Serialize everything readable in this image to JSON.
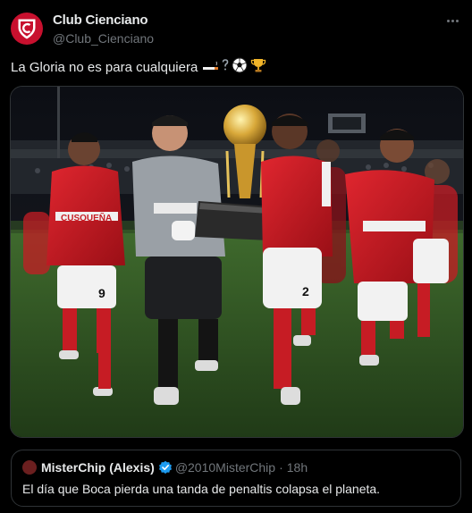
{
  "post": {
    "author": {
      "display_name": "Club Cienciano",
      "handle": "@Club_Cienciano",
      "avatar_icon": "club-cienciano-crest-icon"
    },
    "text": "La Gloria no es para cualquiera",
    "emojis": [
      "cigarette-emoji",
      "question-mark-emoji",
      "soccer-ball-emoji",
      "trophy-emoji"
    ],
    "media": {
      "description_icon": "team-celebration-photo",
      "jersey_sponsor": "CUSQUEÑA",
      "jersey_numbers": [
        "9",
        "2"
      ]
    },
    "quoted": {
      "display_name": "MisterChip (Alexis)",
      "handle": "@2010MisterChip",
      "separator": "·",
      "time": "18h",
      "text": "El día que Boca pierda una tanda de penaltis colapsa el planeta.",
      "verified_icon": "verified-badge-icon"
    }
  },
  "colors": {
    "background": "#000000",
    "text_primary": "#e7e9ea",
    "text_secondary": "#71767b",
    "border": "#2f3336",
    "verified": "#1d9bf0",
    "club_red": "#c8102e"
  }
}
